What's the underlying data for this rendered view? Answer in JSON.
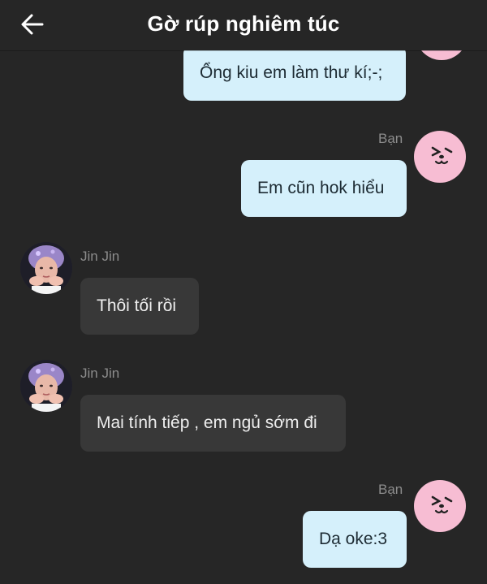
{
  "header": {
    "back_icon": "arrow-left-icon",
    "title": "Gờ rúp nghiêm túc"
  },
  "messages": [
    {
      "sender": "",
      "text": "Ổng kiu em làm thư kí;-;",
      "direction": "outgoing"
    },
    {
      "sender": "Bạn",
      "text": "Em cũn hok hiểu",
      "direction": "outgoing"
    },
    {
      "sender": "Jin Jin",
      "text": "Thôi tối rồi",
      "direction": "incoming"
    },
    {
      "sender": "Jin Jin",
      "text": "Mai tính tiếp , em ngủ sớm đi",
      "direction": "incoming"
    },
    {
      "sender": "Bạn",
      "text": "Dạ oke:3",
      "direction": "outgoing"
    }
  ],
  "colors": {
    "background": "#262626",
    "outgoing_bubble": "#d5f0fb",
    "incoming_bubble": "#383838",
    "own_avatar": "#f7bdd3"
  }
}
